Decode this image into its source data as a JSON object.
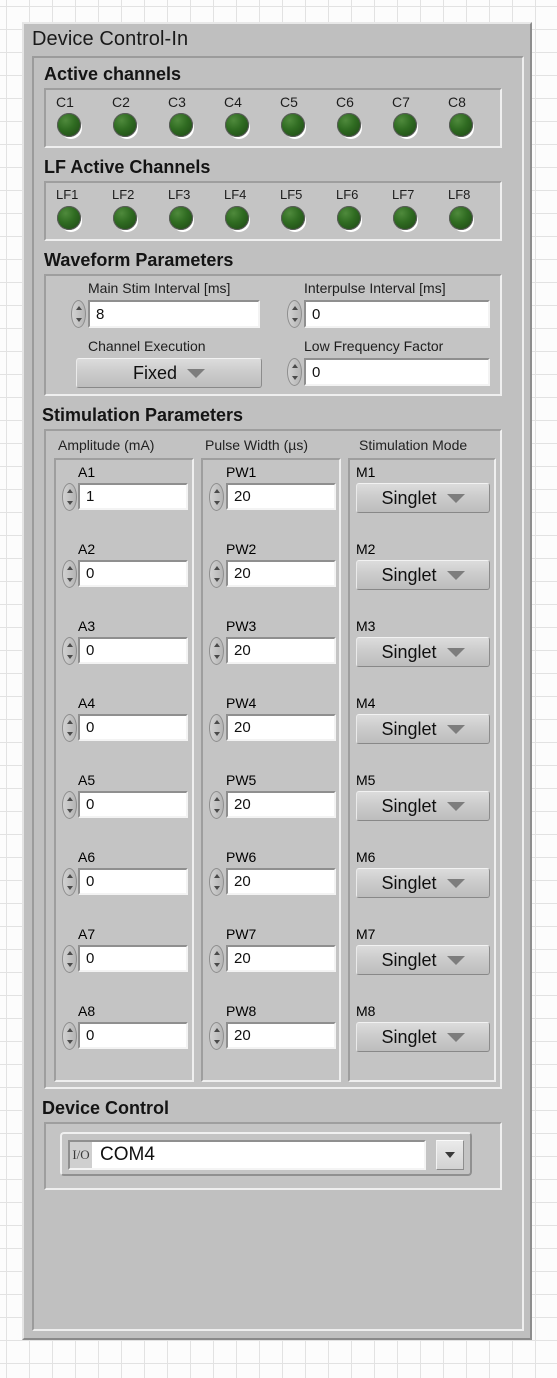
{
  "window": {
    "title": "Device Control-In"
  },
  "sections": {
    "active_channels": {
      "label": "Active channels",
      "channels": [
        {
          "label": "C1",
          "state": "on"
        },
        {
          "label": "C2",
          "state": "on"
        },
        {
          "label": "C3",
          "state": "on"
        },
        {
          "label": "C4",
          "state": "on"
        },
        {
          "label": "C5",
          "state": "on"
        },
        {
          "label": "C6",
          "state": "on"
        },
        {
          "label": "C7",
          "state": "on"
        },
        {
          "label": "C8",
          "state": "on"
        }
      ]
    },
    "lf_active_channels": {
      "label": "LF Active Channels",
      "channels": [
        {
          "label": "LF1",
          "state": "on"
        },
        {
          "label": "LF2",
          "state": "on"
        },
        {
          "label": "LF3",
          "state": "on"
        },
        {
          "label": "LF4",
          "state": "on"
        },
        {
          "label": "LF5",
          "state": "on"
        },
        {
          "label": "LF6",
          "state": "on"
        },
        {
          "label": "LF7",
          "state": "on"
        },
        {
          "label": "LF8",
          "state": "on"
        }
      ]
    },
    "waveform_parameters": {
      "label": "Waveform Parameters",
      "main_stim_interval": {
        "label": "Main Stim Interval [ms]",
        "value": "8"
      },
      "interpulse_interval": {
        "label": "Interpulse Interval [ms]",
        "value": "0"
      },
      "channel_execution": {
        "label": "Channel Execution",
        "value": "Fixed"
      },
      "low_frequency_factor": {
        "label": "Low Frequency Factor",
        "value": "0"
      }
    },
    "stimulation_parameters": {
      "label": "Stimulation Parameters",
      "columns": {
        "amplitude": "Amplitude (mA)",
        "pulse_width": "Pulse Width (µs)",
        "mode": "Stimulation Mode"
      },
      "rows": [
        {
          "amp_label": "A1",
          "amp_value": "1",
          "pw_label": "PW1",
          "pw_value": "20",
          "mode_label": "M1",
          "mode_value": "Singlet"
        },
        {
          "amp_label": "A2",
          "amp_value": "0",
          "pw_label": "PW2",
          "pw_value": "20",
          "mode_label": "M2",
          "mode_value": "Singlet"
        },
        {
          "amp_label": "A3",
          "amp_value": "0",
          "pw_label": "PW3",
          "pw_value": "20",
          "mode_label": "M3",
          "mode_value": "Singlet"
        },
        {
          "amp_label": "A4",
          "amp_value": "0",
          "pw_label": "PW4",
          "pw_value": "20",
          "mode_label": "M4",
          "mode_value": "Singlet"
        },
        {
          "amp_label": "A5",
          "amp_value": "0",
          "pw_label": "PW5",
          "pw_value": "20",
          "mode_label": "M5",
          "mode_value": "Singlet"
        },
        {
          "amp_label": "A6",
          "amp_value": "0",
          "pw_label": "PW6",
          "pw_value": "20",
          "mode_label": "M6",
          "mode_value": "Singlet"
        },
        {
          "amp_label": "A7",
          "amp_value": "0",
          "pw_label": "PW7",
          "pw_value": "20",
          "mode_label": "M7",
          "mode_value": "Singlet"
        },
        {
          "amp_label": "A8",
          "amp_value": "0",
          "pw_label": "PW8",
          "pw_value": "20",
          "mode_label": "M8",
          "mode_value": "Singlet"
        }
      ]
    },
    "device_control": {
      "label": "Device Control",
      "port": {
        "glyph": "I/O",
        "value": "COM4"
      }
    }
  },
  "colors": {
    "led_on": "#2f6b21",
    "panel": "#bfbfbf",
    "inner_panel": "#c0c0c0",
    "field_bg": "#ffffff",
    "text": "#141414"
  }
}
